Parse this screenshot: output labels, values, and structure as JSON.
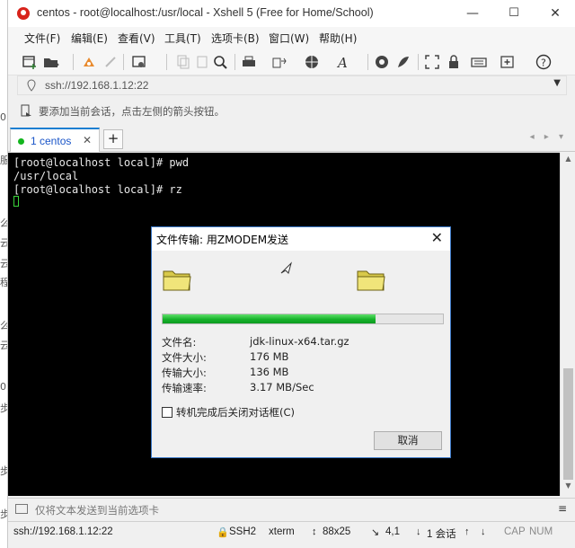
{
  "window": {
    "title": "centos - root@localhost:/usr/local - Xshell 5 (Free for Home/School)",
    "minimize": "—",
    "maximize": "☐",
    "close": "✕"
  },
  "menu": [
    "文件(F)",
    "编辑(E)",
    "查看(V)",
    "工具(T)",
    "选项卡(B)",
    "窗口(W)",
    "帮助(H)"
  ],
  "address": {
    "value": "ssh://192.168.1.12:22"
  },
  "hint": "要添加当前会话，点击左侧的箭头按钮。",
  "tabs": [
    {
      "label": "1 centos"
    }
  ],
  "new_tab": "+",
  "tab_nav": "◂ ▸ ▾",
  "terminal": {
    "lines": [
      "[root@localhost local]# pwd",
      "/usr/local",
      "[root@localhost local]# rz"
    ]
  },
  "dialog": {
    "title": "文件传输: 用ZMODEM发送",
    "close": "✕",
    "progress": 0.76,
    "rows": [
      {
        "label": "文件名:",
        "value": "jdk-linux-x64.tar.gz"
      },
      {
        "label": "文件大小:",
        "value": "176 MB"
      },
      {
        "label": "传输大小:",
        "value": "136 MB"
      },
      {
        "label": "传输速率:",
        "value": "3.17 MB/Sec"
      }
    ],
    "checkbox_label": "转机完成后关闭对话框(C)",
    "cancel_label": "取消"
  },
  "input_bar": {
    "placeholder": "仅将文本发送到当前选项卡",
    "menu": "≡"
  },
  "status": {
    "address": "ssh://192.168.1.12:22",
    "protocol": "SSH2",
    "term": "xterm",
    "size": "88x25",
    "cursor": "4,1",
    "sessions": "1 会话",
    "caps": "CAP",
    "num": "NUM"
  },
  "colors": {
    "accent": "#1b7fd1",
    "progress_green": "#17b22a",
    "terminal_bg": "#000000",
    "cursor_green": "#3ad53a"
  }
}
